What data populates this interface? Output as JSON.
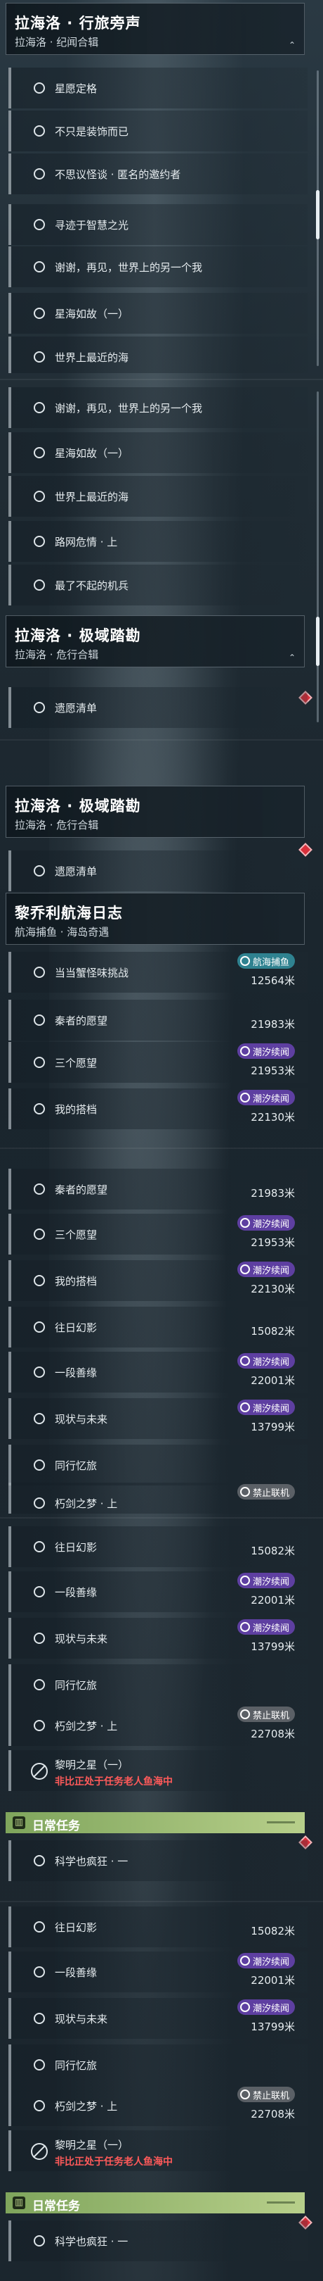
{
  "quests": {
    "laihailuo_xinglv": {
      "title": "拉海洛 · 行旅旁声",
      "subtitle": "拉海洛 · 纪闻合辑"
    },
    "laihailuo_jiyu": {
      "title": "拉海洛 · 极域踏勘",
      "subtitle": "拉海洛 · 危行合辑"
    },
    "liqiaoli": {
      "title": "黎乔利航海日志",
      "subtitle": "航海捕鱼 · 海岛奇遇"
    }
  },
  "tasks": {
    "xingyuan": "星愿定格",
    "buzhishi": "不只是装饰而已",
    "busiyi": "不思议怪谈 · 匿名的邀约者",
    "xunji": "寻迹于智慧之光",
    "xiexie": "谢谢，再见，世界上的另一个我",
    "xinghai": "星海如故（一）",
    "zuijin": "世界上最近的海",
    "lu_wei": "路网危情 · 上",
    "liaobuqi": "最了不起的机兵",
    "zhaoyuan": "遗愿清单",
    "dangdang": "当当蟹怪味挑战",
    "qinzhe": "秦者的愿望",
    "sange": "三个愿望",
    "wode": "我的搭档",
    "wangri": "往日幻影",
    "yiduan": "一段善缘",
    "xianzhuang": "现状与未来",
    "tongxing": "同行忆旅",
    "xiujian": "朽剑之梦 · 上",
    "liming": "黎明之星（一）",
    "kexue": "科学也疯狂 · 一"
  },
  "distances": {
    "dangdang": "12564米",
    "qinzhe": "21983米",
    "sange": "21953米",
    "wode": "22130米",
    "wangri": "15082米",
    "yiduan": "22001米",
    "xianzhuang": "13799米",
    "xiujian": "22708米"
  },
  "badges": {
    "fishing": "航海捕鱼",
    "tide": "潮汐续闻",
    "noonline": "禁止联机"
  },
  "warning_text": "非比正处于任务老人鱼海中",
  "daily_title": "日常任务",
  "colors": {
    "purple": "#5e3fa1",
    "teal": "#2f8290",
    "gray": "#5b6066",
    "daily": "#7fa55c",
    "warn": "#ff5a5a"
  }
}
